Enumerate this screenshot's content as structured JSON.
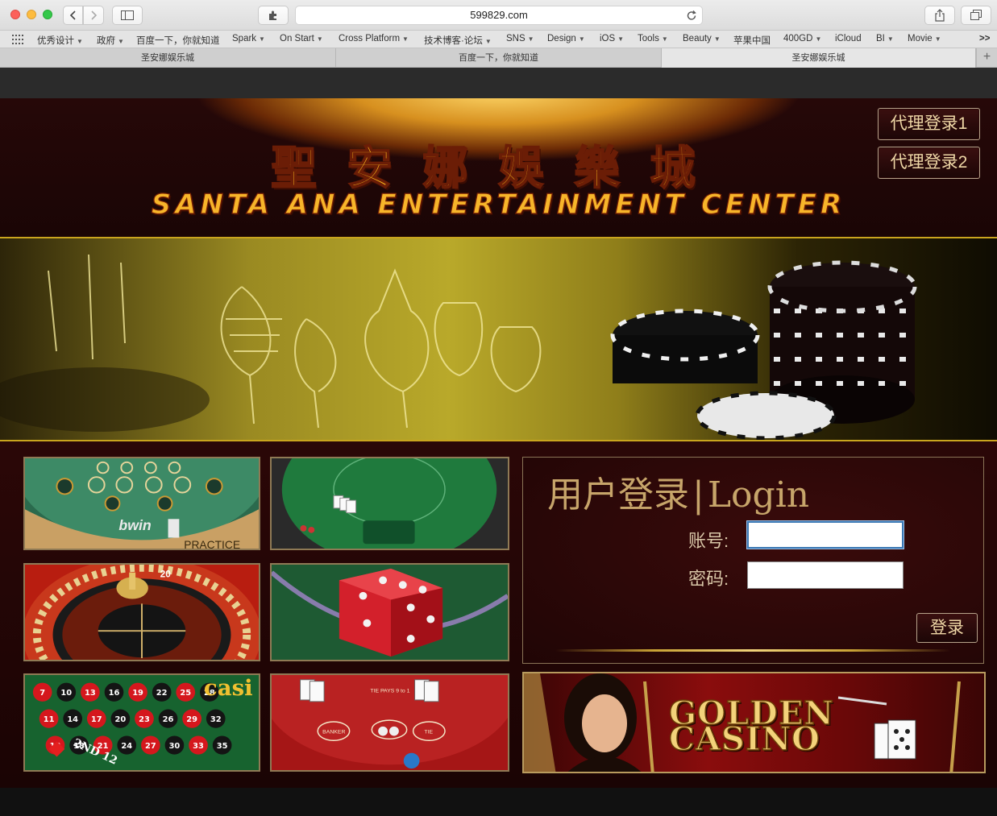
{
  "browser": {
    "url": "599829.com",
    "bookmarks": [
      {
        "label": "优秀设计",
        "chevron": true
      },
      {
        "label": "政府",
        "chevron": true
      },
      {
        "label": "百度一下，你就知道",
        "chevron": false
      },
      {
        "label": "Spark",
        "chevron": true
      },
      {
        "label": "On Start",
        "chevron": true
      },
      {
        "label": "Cross Platform",
        "chevron": true
      },
      {
        "label": "技术博客·论坛",
        "chevron": true
      },
      {
        "label": "SNS",
        "chevron": true
      },
      {
        "label": "Design",
        "chevron": true
      },
      {
        "label": "iOS",
        "chevron": true
      },
      {
        "label": "Tools",
        "chevron": true
      },
      {
        "label": "Beauty",
        "chevron": true
      },
      {
        "label": "苹果中国",
        "chevron": false
      },
      {
        "label": "400GD",
        "chevron": true
      },
      {
        "label": "iCloud",
        "chevron": false
      },
      {
        "label": "BI",
        "chevron": true
      },
      {
        "label": "Movie",
        "chevron": true
      }
    ],
    "overflow": ">>",
    "tabs": [
      {
        "label": "圣安娜娱乐城",
        "active": false
      },
      {
        "label": "百度一下，你就知道",
        "active": false
      },
      {
        "label": "圣安娜娱乐城",
        "active": true
      }
    ],
    "new_tab": "+"
  },
  "header": {
    "logo_cn": "聖安娜娛樂城",
    "logo_en": "SANTA ANA ENTERTAINMENT CENTER",
    "agent_login_1": "代理登录1",
    "agent_login_2": "代理登录2"
  },
  "games": {
    "tile1_text": "bwin",
    "tile1_sub": "PRACTICE",
    "tile3_num": "20",
    "tile5_text": "casi",
    "tile6_payout": "TIE PAYS 9 to 1",
    "tile6_banker": "BANKER",
    "tile6_tie": "TIE",
    "tile5_numbers": [
      "7",
      "10",
      "13",
      "16",
      "19",
      "22",
      "25",
      "28",
      "11",
      "14",
      "17",
      "20",
      "23",
      "26",
      "29",
      "32",
      "12",
      "18",
      "21",
      "24",
      "27",
      "30",
      "33",
      "35"
    ],
    "tile5_dozen": "2ND 12"
  },
  "login": {
    "title_cn": "用户登录",
    "title_sep": "|",
    "title_en": "Login",
    "account_label": "账号:",
    "password_label": "密码:",
    "account_value": "",
    "password_value": "",
    "submit": "登录"
  },
  "ad": {
    "line1": "GOLDEN",
    "line2": "CASINO"
  },
  "colors": {
    "accent_gold": "#f6b21d",
    "header_bg": "#260808",
    "button_border": "#b7a38b"
  }
}
